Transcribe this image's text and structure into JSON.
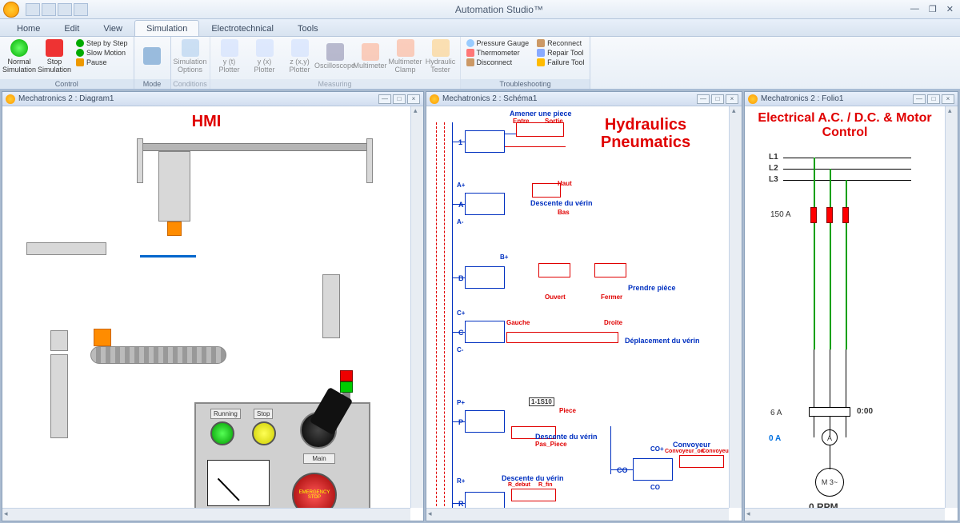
{
  "app_title": "Automation Studio™",
  "tabs": [
    "Home",
    "Edit",
    "View",
    "Simulation",
    "Electrotechnical",
    "Tools"
  ],
  "active_tab": "Simulation",
  "ribbon": {
    "control": {
      "label": "Control",
      "normal": "Normal Simulation",
      "stop": "Stop Simulation",
      "step": "Step by Step",
      "slow": "Slow Motion",
      "pause": "Pause"
    },
    "mode": {
      "label": "Mode"
    },
    "conditions": {
      "label": "Conditions",
      "opts": "Simulation Options"
    },
    "measuring": {
      "label": "Measuring",
      "yt": "y (t) Plotter",
      "yx": "y (x) Plotter",
      "zxy": "z (x,y) Plotter",
      "osc": "Oscilloscope",
      "multi": "Multimeter",
      "clamp": "Multimeter Clamp",
      "tester": "Hydraulic Tester"
    },
    "troubleshooting": {
      "label": "Troubleshooting",
      "pressure": "Pressure Gauge",
      "thermo": "Thermometer",
      "disconnect": "Disconnect",
      "reconnect": "Reconnect",
      "repair": "Repair Tool",
      "failure": "Failure Tool"
    }
  },
  "panels": {
    "hmi": {
      "header": "Mechatronics 2 : Diagram1",
      "title": "HMI",
      "running": "Running",
      "stop": "Stop",
      "main": "Main",
      "estop": "EMERGENCY STOP"
    },
    "hyd": {
      "header": "Mechatronics 2 : Schéma1",
      "title": "Hydraulics Pneumatics",
      "amener": "Amener une piece",
      "entre": "Entre",
      "sortie": "Sortie",
      "haut": "Haut",
      "bas": "Bas",
      "desc_verin": "Descente du vérin",
      "ouvert": "Ouvert",
      "fermer": "Fermer",
      "prendre": "Prendre pièce",
      "gauche": "Gauche",
      "droite": "Droite",
      "deplac": "Déplacement du vérin",
      "piece": "Piece",
      "pas_piece": "Pas_Piece",
      "rdebut": "R_debut",
      "rfin": "R_fin",
      "convoyeur": "Convoyeur",
      "conv_on": "Convoyeur_on",
      "conv_off": "Convoyeur_off",
      "s1": "1-1S10",
      "labels": {
        "v1": "1",
        "va": "A",
        "vb": "B",
        "vc": "C",
        "vp": "P",
        "vr": "R",
        "vco": "CO",
        "ap": "A+",
        "am": "A-",
        "bp": "B+",
        "cp": "C+",
        "cm": "C-",
        "pp": "P+",
        "rp": "R+",
        "r": "R",
        "cop": "CO+",
        "co": "CO"
      }
    },
    "elec": {
      "header": "Mechatronics 2 : Folio1",
      "title": "Electrical A.C. / D.C. & Motor Control",
      "l1": "L1",
      "l2": "L2",
      "l3": "L3",
      "fuse": "150 A",
      "amp6": "6 A",
      "amp0": "0 A",
      "time": "0:00",
      "rpm": "0 RPM",
      "motor": "M 3~"
    }
  }
}
